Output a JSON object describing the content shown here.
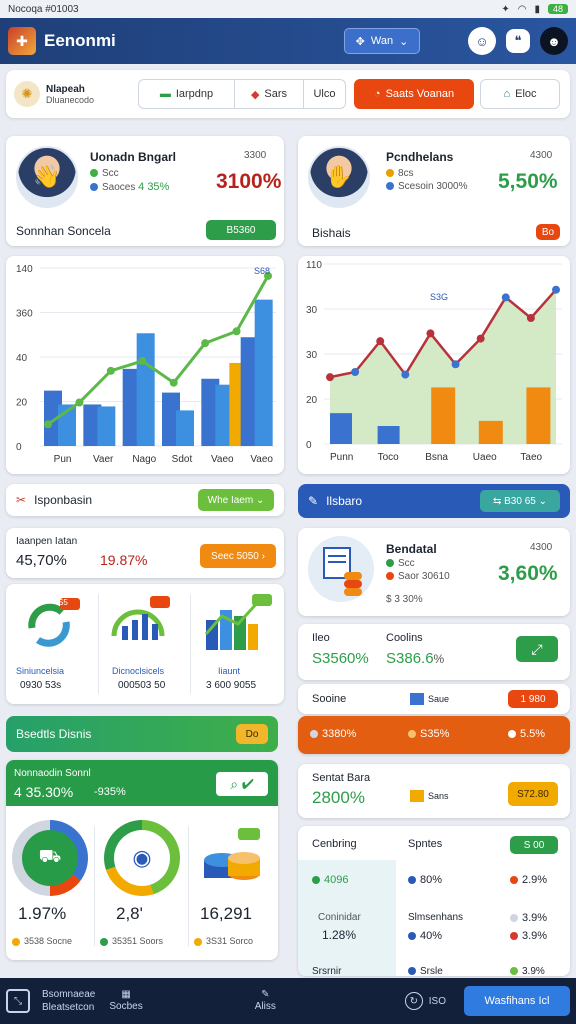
{
  "status": {
    "left": "Nocoqa #01003",
    "battery": "48"
  },
  "header": {
    "title": "Eenonmi",
    "win_btn": "Wan"
  },
  "tabs": {
    "brand_title": "Nlapeah",
    "brand_sub": "Dluanecodo",
    "items": [
      {
        "label": "Iarpdnp"
      },
      {
        "label": "Sars"
      },
      {
        "label": "Ulco"
      },
      {
        "label": "Saats Voanan"
      },
      {
        "label": "Eloc"
      }
    ]
  },
  "profile1": {
    "name": "Uonadn Bngarl",
    "sub_a": "Scc",
    "sub_b": "Saoces",
    "pct_small": "4 35%",
    "top_right": "3300",
    "big": "3100%",
    "footer": "Sonnhan Soncela",
    "badge": "B5360"
  },
  "profile2": {
    "name": "Pcndhelans",
    "sub_a": "8cs",
    "sub_b": "Scesoin 3000%",
    "top_right": "4300",
    "big": "5,50%",
    "footer": "Bishais",
    "badge": "Bo"
  },
  "chart1": {
    "type": "bar",
    "categories": [
      "Pun",
      "Vaer",
      "Nago",
      "Sdot",
      "Vaeo",
      "Vaeo"
    ],
    "ylabels": [
      "140",
      "360",
      "40",
      "20",
      "0"
    ],
    "series": [
      {
        "values": [
          28,
          21,
          39,
          27,
          34,
          55
        ],
        "color": "#3a72d0"
      },
      {
        "values": [
          21,
          20,
          57,
          18,
          31,
          74
        ],
        "color": "#3d8fe0"
      },
      {
        "values": [
          0,
          0,
          0,
          0,
          42,
          0
        ],
        "color": "#f2a900"
      }
    ],
    "line": [
      11,
      22,
      38,
      43,
      32,
      52,
      58,
      86
    ],
    "peak_label": "S68"
  },
  "chart2": {
    "type": "area",
    "categories": [
      "Punn",
      "Toco",
      "Bsna",
      "Uaeo",
      "Taeo"
    ],
    "ylabels": [
      "110",
      "30",
      "30",
      "20",
      "0"
    ],
    "area": [
      26,
      28,
      40,
      27,
      43,
      31,
      41,
      57,
      49,
      60
    ],
    "bars_orange": [
      0,
      0,
      22,
      9,
      22
    ],
    "bars_blue": [
      12,
      7,
      0,
      0,
      0
    ],
    "label_mid": "S3G"
  },
  "section1": {
    "left": "Isponbasin",
    "pill": "Whe Iaem"
  },
  "section2": {
    "left": "Ilsbaro",
    "pill": "B30 65"
  },
  "stats1": {
    "t1": "Iaanpen Iatan",
    "v1": "45,70%",
    "v2": "19.87%",
    "pill": "Seec 5050"
  },
  "mini": [
    {
      "badge": "S5",
      "label": "Siniuncelsia",
      "val": "0930 53s"
    },
    {
      "badge": "S5",
      "label": "Dicnoclsicels",
      "val": "000503 50"
    },
    {
      "badge": "S0",
      "label": "Iiaunt",
      "val": "3 600 9055"
    }
  ],
  "report": {
    "title": "Bendatal",
    "sub_a": "Scc",
    "sub_b": "Saor 30610",
    "sub_c": "3 30%",
    "top_right": "4300",
    "big": "3,60%"
  },
  "kpi": {
    "l1": "Ileo",
    "l2": "Coolins",
    "v1": "S3560%",
    "v2": "S386.6",
    "v2_suffix": "%"
  },
  "sooms": {
    "label": "Sooine",
    "legend": "Saue",
    "pill": "1 980"
  },
  "orange_bar": {
    "a": "3380%",
    "b": "S35%",
    "c": "5.5%"
  },
  "section3": {
    "left": "Bsedtls Disnis",
    "pill": "Do"
  },
  "green_card": {
    "title": "Nonnaodin Sonnl",
    "v1": "4 35.30%",
    "v2": "-935%"
  },
  "rings": [
    {
      "val": "1.97%",
      "foot": "3538 Socne"
    },
    {
      "val": "2,8'",
      "foot": "35351 Soors"
    },
    {
      "val": "16,291",
      "foot": "3S31 Sorco"
    }
  ],
  "sentat": {
    "title": "Sentat Bara",
    "val": "2800%",
    "legend": "Sans",
    "pill": "S72.80"
  },
  "table": {
    "h1": "Cenbring",
    "h2": "Spntes",
    "pill": "S 00",
    "r1a": "4096",
    "r1b": "80%",
    "r1c": "2.9%",
    "sub1": "Coninidar",
    "sub1v": "1.28%",
    "sub2": "Slmsenhans",
    "r2b": "40%",
    "r2c": "3.9%",
    "r2d": "3.9%",
    "r3a": "Srsrnir",
    "r3b": "Srsle",
    "r3c": "3.9%"
  },
  "bottom": {
    "left_t1": "Bsomnaeae",
    "left_t2": "Bleatsetcon",
    "tab1": "Socbes",
    "tab2": "Aliss",
    "action": "Wasfihans Icl",
    "page": "ISO"
  }
}
